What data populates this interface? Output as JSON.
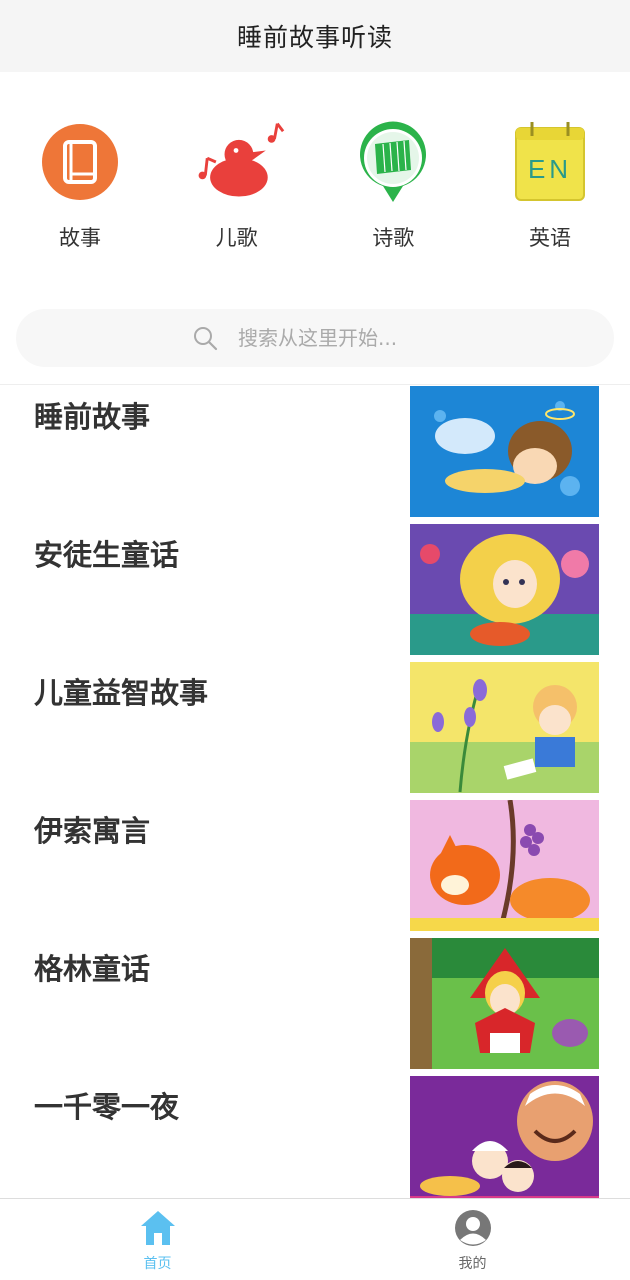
{
  "header": {
    "title": "睡前故事听读"
  },
  "categories": [
    {
      "label": "故事",
      "icon": "book-icon"
    },
    {
      "label": "儿歌",
      "icon": "duck-music-icon"
    },
    {
      "label": "诗歌",
      "icon": "poem-pin-icon"
    },
    {
      "label": "英语",
      "icon": "english-calendar-icon",
      "icon_text": "EN"
    }
  ],
  "search": {
    "placeholder": "搜索从这里开始..."
  },
  "list": [
    {
      "title": "睡前故事"
    },
    {
      "title": "安徒生童话"
    },
    {
      "title": "儿童益智故事"
    },
    {
      "title": "伊索寓言"
    },
    {
      "title": "格林童话"
    },
    {
      "title": "一千零一夜"
    }
  ],
  "tabbar": {
    "home_label": "首页",
    "mine_label": "我的",
    "active_color": "#5bc0f0",
    "inactive_color": "#666666"
  }
}
